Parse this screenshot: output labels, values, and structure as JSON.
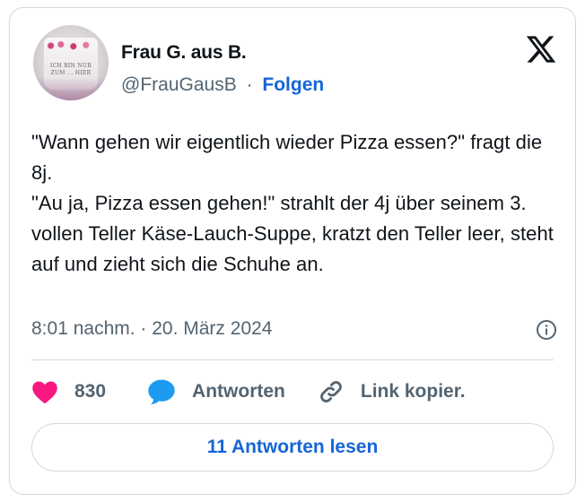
{
  "author": {
    "name": "Frau G. aus B.",
    "handle": "@FrauGausB",
    "separator": "·",
    "follow_label": "Folgen",
    "avatar_text": "ICH BIN NUR ZUM ... HIER"
  },
  "tweet": {
    "text": "\"Wann gehen wir eigentlich wieder Pizza essen?\" fragt die 8j.\n\"Au ja, Pizza essen gehen!\" strahlt der 4j über seinem 3. vollen Teller Käse-Lauch-Suppe, kratzt den Teller leer, steht auf und zieht sich die Schuhe an.",
    "timestamp": "8:01 nachm. · 20. März 2024"
  },
  "actions": {
    "like_count": "830",
    "reply_label": "Antworten",
    "copy_label": "Link kopier."
  },
  "read_replies_label": "11 Antworten lesen",
  "icons": {
    "logo": "x-logo-icon",
    "info": "info-icon",
    "like": "heart-icon",
    "reply": "speech-bubble-icon",
    "copy": "link-icon"
  },
  "colors": {
    "heart": "#f91880",
    "reply_bubble": "#1d9bf0",
    "link_blue": "#1565d8",
    "muted": "#536471",
    "border": "#cfd9de"
  }
}
